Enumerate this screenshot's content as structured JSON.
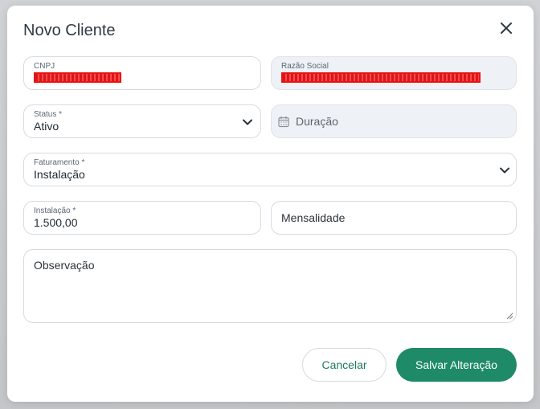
{
  "modal": {
    "title": "Novo Cliente",
    "close_icon": "close-icon"
  },
  "fields": {
    "cnpj": {
      "label": "CNPJ",
      "value_redacted": true
    },
    "razao_social": {
      "label": "Razão Social",
      "value_redacted": true
    },
    "status": {
      "label": "Status *",
      "value": "Ativo",
      "icon": "chevron-down-icon"
    },
    "duracao": {
      "placeholder": "Duração",
      "icon": "calendar-icon"
    },
    "faturamento": {
      "label": "Faturamento *",
      "value": "Instalação",
      "icon": "chevron-down-icon"
    },
    "instalacao": {
      "label": "Instalação *",
      "value": "1.500,00"
    },
    "mensalidade": {
      "placeholder": "Mensalidade"
    },
    "observacao": {
      "placeholder": "Observação"
    }
  },
  "actions": {
    "cancel_label": "Cancelar",
    "save_label": "Salvar Alteração"
  },
  "colors": {
    "accent": "#1e8a68",
    "accent_text": "#1e7a5e",
    "disabled_bg": "#eef1f5",
    "border": "#d6dbe1",
    "redaction": "#ee1111"
  }
}
